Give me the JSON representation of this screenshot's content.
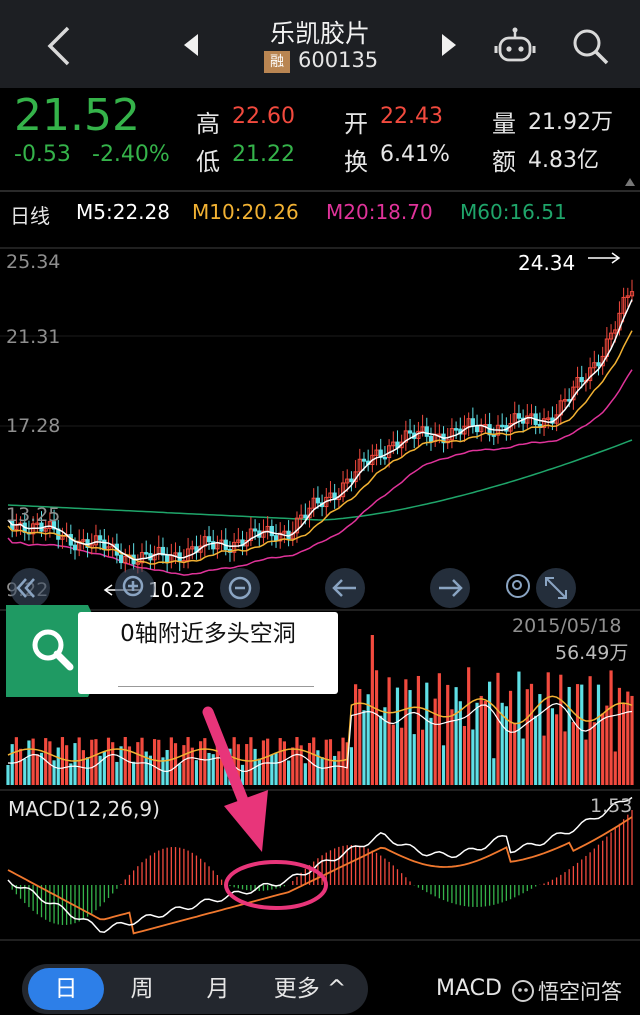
{
  "header": {
    "stock_name": "乐凯胶片",
    "margin_tag": "融",
    "stock_code": "600135"
  },
  "quote": {
    "price": "21.52",
    "change": "-0.53",
    "change_pct": "-2.40%",
    "high_label": "高",
    "high": "22.60",
    "low_label": "低",
    "low": "21.22",
    "open_label": "开",
    "open": "22.43",
    "turnover_label": "换",
    "turnover": "6.41%",
    "volume_label": "量",
    "volume": "21.92万",
    "amount_label": "额",
    "amount": "4.83亿"
  },
  "ma_bar": {
    "period": "日线",
    "m5": "M5:22.28",
    "m10": "M10:20.26",
    "m20": "M20:18.70",
    "m60": "M60:16.51"
  },
  "price_chart": {
    "y_labels": [
      "25.34",
      "21.31",
      "17.28",
      "13.25",
      "9.22"
    ],
    "high_marker": "24.34",
    "low_marker": "10.22",
    "date_label": "2015/05/18"
  },
  "volume_panel": {
    "max_label": "56.49万"
  },
  "macd_panel": {
    "title": "MACD(12,26,9)",
    "max_label": "1.53"
  },
  "callout": {
    "text": "0轴附近多头空洞"
  },
  "tabs": {
    "day": "日",
    "week": "周",
    "month": "月",
    "more": "更多 ^"
  },
  "bottom_right": {
    "indicator": "MACD",
    "watermark": "悟空问答"
  },
  "colors": {
    "up": "#f24a3e",
    "down": "#5fe0e6",
    "price_down_text": "#35b34a",
    "ma5": "#ffffff",
    "ma10": "#f2b233",
    "ma20": "#e0339a",
    "ma60": "#1fa56a",
    "annotation": "#e8357a",
    "tab_active": "#2d7fe8"
  }
}
